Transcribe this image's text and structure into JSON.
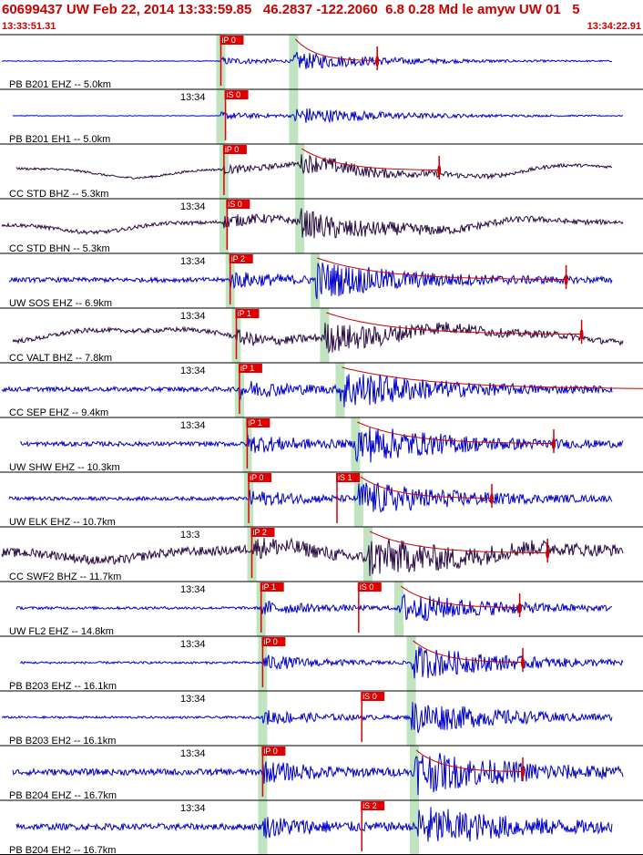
{
  "header": {
    "title": "60699437 UW Feb 22, 2014 13:33:59.85   46.2837 -122.2060  6.8 0.28 Md le amyw UW 01   5",
    "start_time": "13:33:51.31",
    "end_time": "13:34:22.91"
  },
  "colors": {
    "header_text": "#cc0000",
    "trace_blue": "#0000cc",
    "trace_dark": "#2a0a45",
    "pick_bg": "#e00000",
    "pick_text": "#ffffff",
    "green_band": "#bfe4bf",
    "coda_line": "#cc0000",
    "divider": "#000000"
  },
  "chart_data": {
    "type": "seismogram",
    "time_window": {
      "start": "13:33:51.31",
      "end": "13:34:22.91"
    },
    "traces": [
      {
        "label": "PB B201 EHZ -- 5.0km",
        "time_label": "",
        "color": "blue",
        "amp": 9,
        "noise": 0.4,
        "p_s": 1.25,
        "s_s": 3.6,
        "picks": [
          {
            "t": 1.25,
            "label": "iP 0"
          }
        ],
        "coda_end_s": 6.3
      },
      {
        "label": "PB B201 EH1 -- 5.0km",
        "time_label": "13:34",
        "color": "blue",
        "amp": 9,
        "noise": 0.3,
        "p_s": 1.25,
        "s_s": 3.6,
        "picks": [
          {
            "t": 1.4,
            "label": "iS 0"
          }
        ],
        "coda_end_s": null
      },
      {
        "label": "CC STD BHZ -- 5.3km",
        "time_label": "",
        "color": "dark",
        "amp": 9,
        "noise": 1.2,
        "p_s": 1.35,
        "s_s": 3.8,
        "picks": [
          {
            "t": 1.35,
            "label": "iP 0"
          }
        ],
        "coda_end_s": 8.3
      },
      {
        "label": "CC STD BHN -- 5.3km",
        "time_label": "13:34",
        "color": "dark",
        "amp": 13,
        "noise": 2.0,
        "p_s": 1.35,
        "s_s": 3.8,
        "picks": [
          {
            "t": 1.45,
            "label": "iS 0"
          }
        ],
        "coda_end_s": null
      },
      {
        "label": "UW SOS EHZ -- 6.9km",
        "time_label": "13:34",
        "color": "blue",
        "amp": 18,
        "noise": 2.5,
        "p_s": 1.55,
        "s_s": 4.3,
        "picks": [
          {
            "t": 1.55,
            "label": "iP 2"
          }
        ],
        "coda_end_s": 12.4
      },
      {
        "label": "CC VALT BHZ -- 7.8km",
        "time_label": "13:34",
        "color": "dark",
        "amp": 14,
        "noise": 2.5,
        "p_s": 1.75,
        "s_s": 4.6,
        "picks": [
          {
            "t": 1.75,
            "label": "iP 1"
          }
        ],
        "coda_end_s": 12.9
      },
      {
        "label": "CC SEP EHZ -- 9.4km",
        "time_label": "13:34",
        "color": "blue",
        "amp": 20,
        "noise": 2.5,
        "p_s": 1.85,
        "s_s": 5.1,
        "picks": [
          {
            "t": 1.85,
            "label": "iP 1"
          }
        ],
        "coda_end_s": 16.4
      },
      {
        "label": "UW SHW EHZ -- 10.3km",
        "time_label": "13:34",
        "color": "blue",
        "amp": 20,
        "noise": 2.5,
        "p_s": 2.1,
        "s_s": 5.6,
        "picks": [
          {
            "t": 2.1,
            "label": "iP 1"
          }
        ],
        "coda_end_s": 12.0
      },
      {
        "label": "UW ELK EHZ -- 10.7km",
        "time_label": "",
        "color": "blue",
        "amp": 18,
        "noise": 2.0,
        "p_s": 2.15,
        "s_s": 5.7,
        "picks": [
          {
            "t": 2.15,
            "label": "iP 0"
          },
          {
            "t": 5.0,
            "label": "iS 1"
          }
        ],
        "coda_end_s": 10.0
      },
      {
        "label": "CC SWF2 BHZ -- 11.7km",
        "time_label": "13:3",
        "color": "dark",
        "amp": 18,
        "noise": 5.0,
        "p_s": 2.25,
        "s_s": 6.0,
        "picks": [
          {
            "t": 2.25,
            "label": "iP 2"
          }
        ],
        "coda_end_s": 11.8
      },
      {
        "label": "UW FL2 EHZ -- 14.8km",
        "time_label": "13:34",
        "color": "blue",
        "amp": 16,
        "noise": 1.5,
        "p_s": 2.55,
        "s_s": 7.0,
        "picks": [
          {
            "t": 2.55,
            "label": "iP 1"
          },
          {
            "t": 5.7,
            "label": "iS 0"
          }
        ],
        "coda_end_s": 10.9
      },
      {
        "label": "PB B203 EHZ -- 16.1km",
        "time_label": "13:34",
        "color": "blue",
        "amp": 18,
        "noise": 1.2,
        "p_s": 2.6,
        "s_s": 7.4,
        "picks": [
          {
            "t": 2.6,
            "label": "iP 0"
          }
        ],
        "coda_end_s": 11.0
      },
      {
        "label": "PB B203 EH2 -- 16.1km",
        "time_label": "13:34",
        "color": "blue",
        "amp": 18,
        "noise": 1.2,
        "p_s": 2.6,
        "s_s": 7.4,
        "picks": [
          {
            "t": 5.8,
            "label": "iS 0"
          }
        ],
        "coda_end_s": null
      },
      {
        "label": "PB B204 EHZ -- 16.7km",
        "time_label": "13:34",
        "color": "blue",
        "amp": 22,
        "noise": 3.5,
        "p_s": 2.6,
        "s_s": 7.5,
        "picks": [
          {
            "t": 2.6,
            "label": "iP 0"
          }
        ],
        "coda_end_s": 11.0
      },
      {
        "label": "PB B204 EH2 -- 16.7km",
        "time_label": "13:34",
        "color": "blue",
        "amp": 22,
        "noise": 3.5,
        "p_s": 2.6,
        "s_s": 7.5,
        "picks": [
          {
            "t": 5.8,
            "label": "iS 2"
          }
        ],
        "coda_end_s": null
      }
    ]
  }
}
